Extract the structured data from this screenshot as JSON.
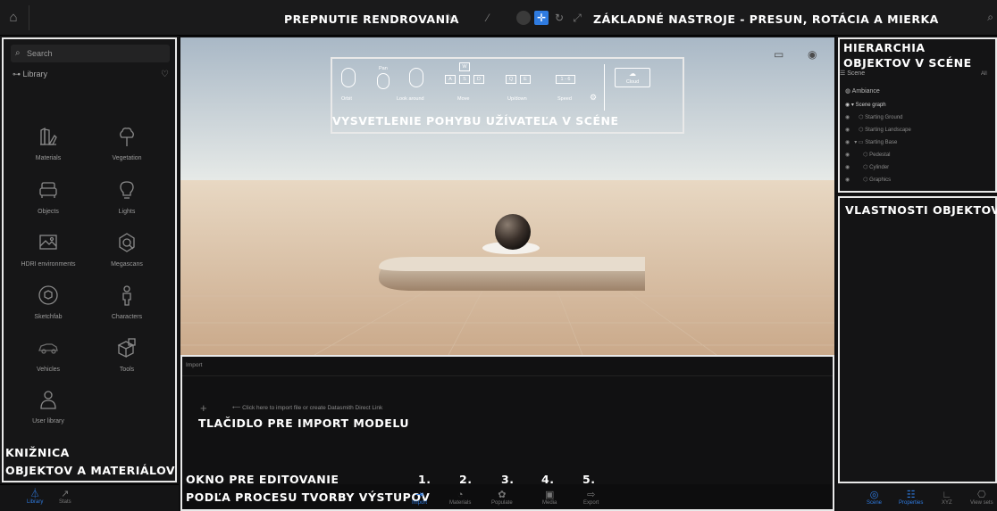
{
  "topbar": {
    "render_switch_label": "PREPNUTIE RENDROVANIA",
    "tools_label": "ZÁKLADNÉ NASTROJE - PRESUN, ROTÁCIA A MIERKA"
  },
  "left": {
    "search_placeholder": "Search",
    "library_title": "Library",
    "items": [
      {
        "label": "Materials",
        "icon": "materials-icon"
      },
      {
        "label": "Vegetation",
        "icon": "vegetation-icon"
      },
      {
        "label": "Objects",
        "icon": "objects-icon"
      },
      {
        "label": "Lights",
        "icon": "lights-icon"
      },
      {
        "label": "HDRI environments",
        "icon": "hdri-icon"
      },
      {
        "label": "Megascans",
        "icon": "megascans-icon"
      },
      {
        "label": "Sketchfab",
        "icon": "sketchfab-icon"
      },
      {
        "label": "Characters",
        "icon": "characters-icon"
      },
      {
        "label": "Vehicles",
        "icon": "vehicles-icon"
      },
      {
        "label": "Tools",
        "icon": "tools-icon"
      },
      {
        "label": "User library",
        "icon": "user-library-icon"
      }
    ],
    "annotation_line1": "KNIŽNICA",
    "annotation_line2": "OBJEKTOV A MATERIÁLOV",
    "nav": [
      {
        "label": "Library",
        "active": true
      },
      {
        "label": "Stats",
        "active": false
      }
    ]
  },
  "viewport": {
    "hud": [
      {
        "label": "Orbit"
      },
      {
        "label": "Pan"
      },
      {
        "label": "Look around"
      },
      {
        "label": "Move"
      },
      {
        "label": "Up/down"
      },
      {
        "label": "Speed"
      },
      {
        "label": "Cloud"
      }
    ],
    "hud_keys": {
      "w": "W",
      "a": "A",
      "s": "S",
      "d": "D",
      "q": "Q",
      "e": "E",
      "speed": "1 - 6"
    },
    "annotation": "VYSVETLENIE POHYBU UŽÍVATEĽA V SCÉNE"
  },
  "edit": {
    "header": "Import",
    "hint": "Click here to import file or create Datasmith Direct Link",
    "import_annotation": "TLAČIDLO PRE IMPORT MODELU",
    "annotation_line1": "OKNO PRE EDITOVANIE",
    "annotation_line2": "PODĽA PROCESU TVORBY VÝSTUPOV",
    "steps": [
      "1.",
      "2.",
      "3.",
      "4.",
      "5."
    ],
    "nav": [
      {
        "label": "Import",
        "active": true
      },
      {
        "label": "Materials",
        "active": false
      },
      {
        "label": "Populate",
        "active": false
      },
      {
        "label": "Media",
        "active": false
      },
      {
        "label": "Export",
        "active": false
      }
    ]
  },
  "right": {
    "hier_line1": "HIERARCHIA",
    "hier_line2": "OBJEKTOV V SCÉNE",
    "scene_label": "Scene",
    "all_label": "All",
    "tree": [
      {
        "label": "Ambiance",
        "indent": 0
      },
      {
        "label": "Scene graph",
        "indent": 1
      },
      {
        "label": "Starting Ground",
        "indent": 2
      },
      {
        "label": "Starting Landscape",
        "indent": 2
      },
      {
        "label": "Starting Base",
        "indent": 2
      },
      {
        "label": "Pedestal",
        "indent": 3
      },
      {
        "label": "Cylinder",
        "indent": 3
      },
      {
        "label": "Graphics",
        "indent": 3
      }
    ],
    "props_annotation": "VLASTNOSTI OBJEKTOV",
    "nav": [
      {
        "label": "Scene",
        "active": true
      },
      {
        "label": "Properties",
        "active": true
      },
      {
        "label": "XYZ",
        "active": false
      },
      {
        "label": "View sets",
        "active": false
      }
    ]
  },
  "colors": {
    "accent": "#2f7be0",
    "outline": "#e9e9e9",
    "sand": "#dcc3a6",
    "sky": "#cfd8df"
  }
}
